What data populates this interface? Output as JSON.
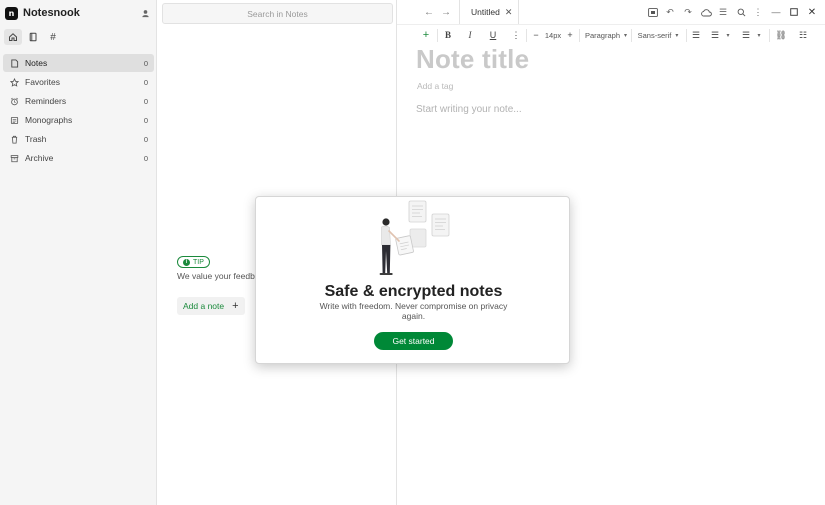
{
  "app": {
    "name": "Notesnook"
  },
  "sidebar": {
    "tabs": [
      {
        "icon": "home-icon"
      },
      {
        "icon": "notebook-icon"
      },
      {
        "icon": "tag-icon"
      }
    ],
    "items": [
      {
        "label": "Notes",
        "count": "0",
        "icon": "note-icon",
        "active": true
      },
      {
        "label": "Favorites",
        "count": "0",
        "icon": "star-icon"
      },
      {
        "label": "Reminders",
        "count": "0",
        "icon": "alarm-icon"
      },
      {
        "label": "Monographs",
        "count": "0",
        "icon": "monograph-icon"
      },
      {
        "label": "Trash",
        "count": "0",
        "icon": "trash-icon"
      },
      {
        "label": "Archive",
        "count": "0",
        "icon": "archive-icon"
      }
    ]
  },
  "notes_list": {
    "search_placeholder": "Search in Notes",
    "tip_label": "TIP",
    "tip_text": "We value your feedbac your experiences and",
    "add_note_label": "Add a note"
  },
  "editor": {
    "tab_title": "Untitled",
    "font_size": "14px",
    "block_type": "Paragraph",
    "font_family": "Sans-serif",
    "title_placeholder": "Note title",
    "tag_placeholder": "Add a tag",
    "body_placeholder": "Start writing your note..."
  },
  "modal": {
    "title": "Safe & encrypted notes",
    "subtitle": "Write with freedom. Never compromise on privacy again.",
    "cta_label": "Get started"
  },
  "colors": {
    "accent": "#008837",
    "sidebar_bg": "#f5f5f5",
    "placeholder": "#c9c9c9"
  }
}
